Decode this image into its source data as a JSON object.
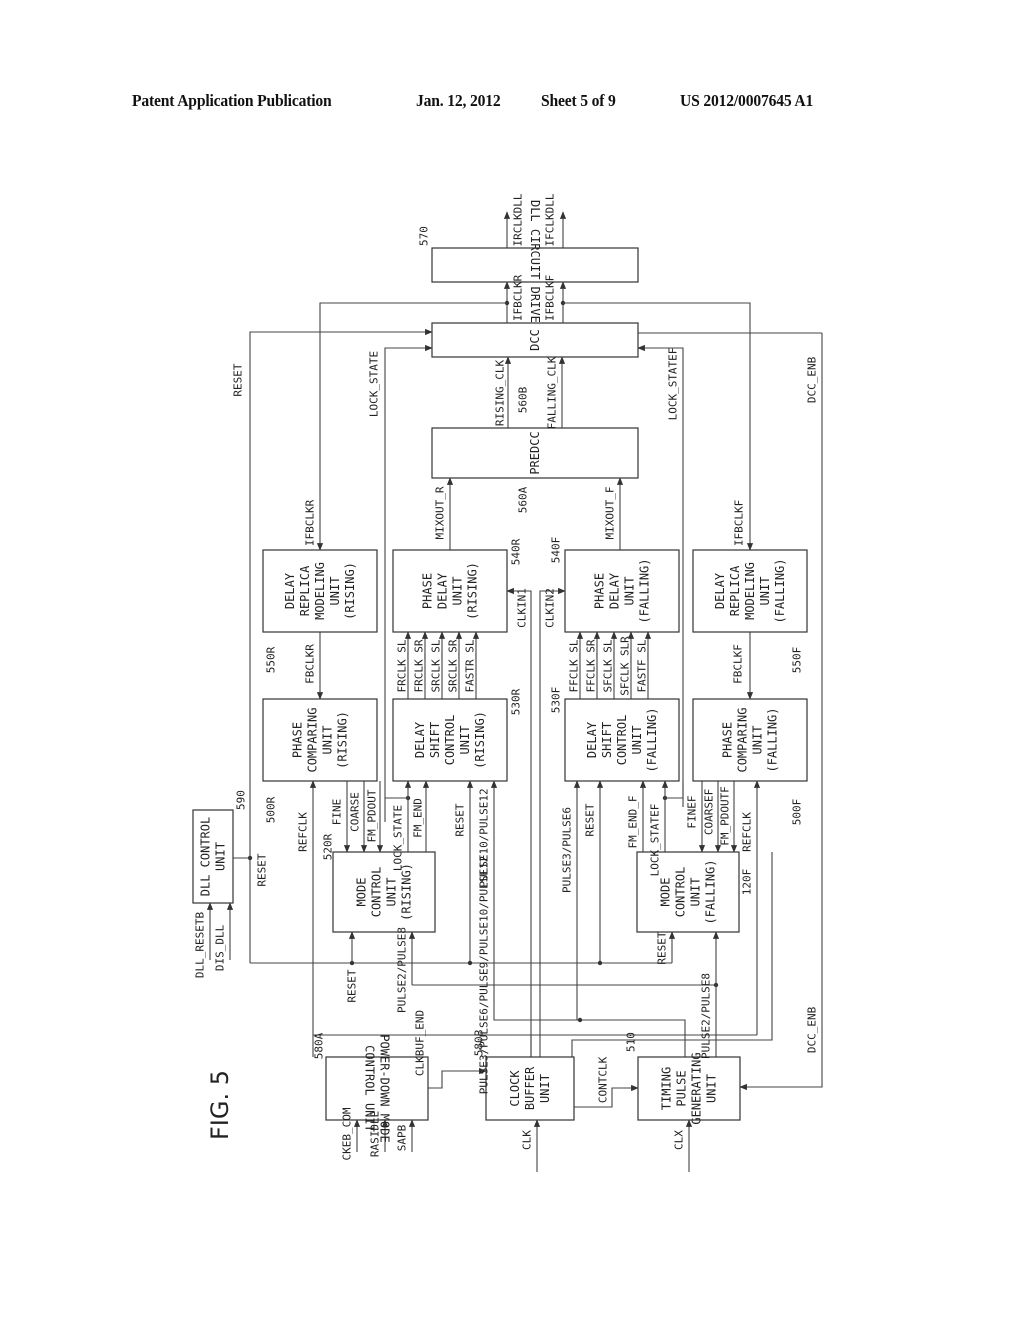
{
  "header": {
    "publication": "Patent Application Publication",
    "date": "Jan. 12, 2012",
    "sheet": "Sheet 5 of 9",
    "number": "US 2012/0007645 A1"
  },
  "figure": {
    "title": "FIG. 5",
    "blocks": {
      "dll_circuit_driver": {
        "label": [
          "DLL CIRCUIT DRIVER"
        ],
        "ref": "570"
      },
      "dcc": {
        "label": [
          "DCC"
        ],
        "ref": "560B"
      },
      "predcc": {
        "label": [
          "PREDCC"
        ],
        "ref": "560A"
      },
      "delay_replica_rising": {
        "label": [
          "DELAY",
          "REPLICA",
          "MODELING",
          "UNIT",
          "(RISING)"
        ],
        "ref": "550R"
      },
      "phase_delay_rising": {
        "label": [
          "PHASE",
          "DELAY",
          "UNIT",
          "(RISING)"
        ],
        "ref": "540R"
      },
      "phase_delay_falling": {
        "label": [
          "PHASE",
          "DELAY",
          "UNIT",
          "(FALLING)"
        ],
        "ref": "540F"
      },
      "delay_replica_falling": {
        "label": [
          "DELAY",
          "REPLICA",
          "MODELING",
          "UNIT",
          "(FALLING)"
        ],
        "ref": "550F"
      },
      "phase_comparing_rising": {
        "label": [
          "PHASE",
          "COMPARING",
          "UNIT",
          "(RISING)"
        ],
        "ref": "500R"
      },
      "delay_shift_rising": {
        "label": [
          "DELAY",
          "SHIFT",
          "CONTROL",
          "UNIT",
          "(RISING)"
        ],
        "ref": "530R"
      },
      "delay_shift_falling": {
        "label": [
          "DELAY",
          "SHIFT",
          "CONTROL",
          "UNIT",
          "(FALLING)"
        ],
        "ref": "530F"
      },
      "phase_comparing_falling": {
        "label": [
          "PHASE",
          "COMPARING",
          "UNIT",
          "(FALLING)"
        ],
        "ref": "500F"
      },
      "dll_control": {
        "label": [
          "DLL CONTROL",
          "UNIT"
        ],
        "ref": "590"
      },
      "mode_control_rising": {
        "label": [
          "MODE",
          "CONTROL",
          "UNIT",
          "(RISING)"
        ],
        "ref": "520R"
      },
      "mode_control_falling": {
        "label": [
          "MODE",
          "CONTROL",
          "UNIT",
          "(FALLING)"
        ],
        "ref": "120F"
      },
      "power_down": {
        "label": [
          "POWER-DOWN MODE",
          "CONTROL UNIT"
        ],
        "ref": "580A"
      },
      "clock_buffer": {
        "label": [
          "CLOCK",
          "BUFFER",
          "UNIT"
        ],
        "ref": "580B"
      },
      "timing_pulse": {
        "label": [
          "TIMING",
          "PULSE",
          "GENERATING",
          "UNIT"
        ],
        "ref": "510"
      }
    },
    "signals": {
      "irclkdll": "IRCLKDLL",
      "ifclkdll": "IFCLKDLL",
      "ifbclkr": "IFBCLKR",
      "ifbclkf": "IFBCLKF",
      "reset": "RESET",
      "lock_state": "LOCK_STATE",
      "lock_statef": "LOCK_STATEF",
      "rising_clk": "RISING_CLK",
      "falling_clk": "FALLING_CLK",
      "dcc_enb": "DCC_ENB",
      "mixout_r": "MIXOUT_R",
      "mixout_f": "MIXOUT_F",
      "fbclkr": "FBCLKR",
      "fbclkf": "FBCLKF",
      "clkin1": "CLKIN1",
      "clkin2": "CLKIN2",
      "frclk_sl": "FRCLK_SL",
      "frclk_sr": "FRCLK_SR",
      "srclk_sl": "SRCLK_SL",
      "srclk_sr": "SRCLK_SR",
      "fastr_sl": "FASTR_SL",
      "ffclk_sl": "FFCLK_SL",
      "ffclk_sr": "FFCLK_SR",
      "sfclk_sl": "SFCLK_SL",
      "sfclk_slr": "SFCLK_SLR",
      "fastf_sl": "FASTF_SL",
      "refclk": "REFCLK",
      "fine": "FINE",
      "coarse": "COARSE",
      "fm_pdout": "FM_PDOUT",
      "fm_end": "FM_END",
      "pulse10_12": "PULSE10/PULSE12",
      "pulse3_6": "PULSE3/PULSE6",
      "fm_end_f": "FM_END_F",
      "finef": "FINEF",
      "coarsef": "COARSEF",
      "fm_pdoutf": "FM_PDOUTF",
      "pulse2_8": "PULSE2/PULSE8",
      "pulse_long": "PULSE3/PULSE6/PULSE9/PULSE10/PULSE12",
      "dll_resetb": "DLL_RESETB",
      "dis_dll": "DIS_DLL",
      "ckeb_com": "CKEB_COM",
      "rasidle": "RASIDLE",
      "sapb": "SAPB",
      "clkbuf_end": "CLKBUF_END",
      "contclk": "CONTCLK",
      "clk": "CLK",
      "clx": "CLX"
    }
  }
}
